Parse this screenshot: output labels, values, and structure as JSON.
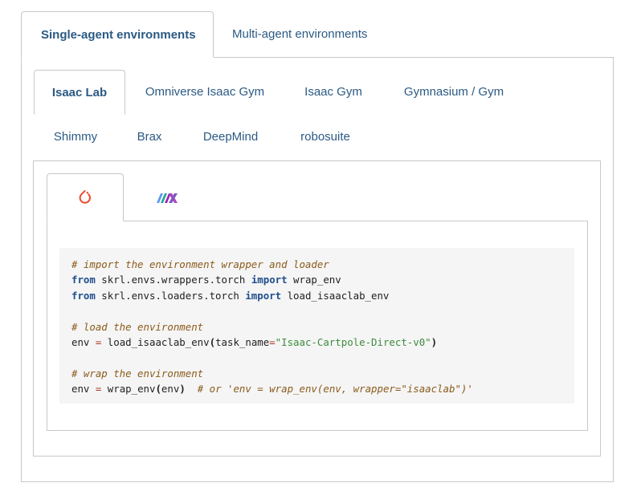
{
  "outer_tabs": {
    "single": "Single-agent environments",
    "multi": "Multi-agent environments"
  },
  "env_tabs": {
    "isaac_lab": "Isaac Lab",
    "omniverse": "Omniverse Isaac Gym",
    "isaac_gym": "Isaac Gym",
    "gymnasium": "Gymnasium / Gym",
    "shimmy": "Shimmy",
    "brax": "Brax",
    "deepmind": "DeepMind",
    "robosuite": "robosuite"
  },
  "framework_tabs": {
    "active_icon": "pytorch-icon",
    "inactive_icon": "jax-icon"
  },
  "code": {
    "l1": "# import the environment wrapper and loader",
    "l2_kw1": "from",
    "l2_mod": " skrl.envs.wrappers.torch ",
    "l2_kw2": "import",
    "l2_name": " wrap_env",
    "l3_kw1": "from",
    "l3_mod": " skrl.envs.loaders.torch ",
    "l3_kw2": "import",
    "l3_name": " load_isaaclab_env",
    "l5": "# load the environment",
    "l6_a": "env ",
    "l6_eq": "=",
    "l6_b": " load_isaaclab_env",
    "l6_p1": "(",
    "l6_c": "task_name",
    "l6_eq2": "=",
    "l6_str": "\"Isaac-Cartpole-Direct-v0\"",
    "l6_p2": ")",
    "l8": "# wrap the environment",
    "l9_a": "env ",
    "l9_eq": "=",
    "l9_b": " wrap_env",
    "l9_p1": "(",
    "l9_c": "env",
    "l9_p2": ")",
    "l9_cm": "  # or 'env = wrap_env(env, wrapper=\"isaaclab\")'"
  },
  "colors": {
    "link": "#2b5a84",
    "border": "#c6c9c8",
    "code_bg": "#f5f5f5",
    "pytorch": "#ee4c2c"
  }
}
